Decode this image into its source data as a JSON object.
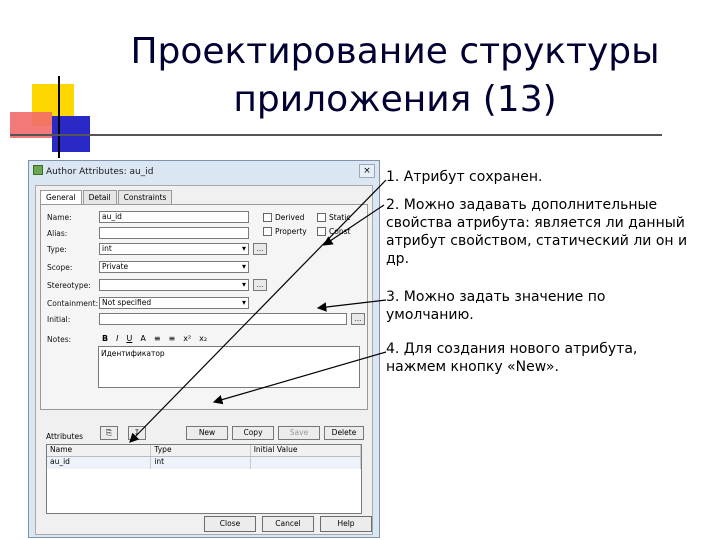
{
  "slide": {
    "title_line1": "Проектирование структуры",
    "title_line2": "приложения (13)"
  },
  "dialog": {
    "title": "Author Attributes: au_id",
    "close": "×",
    "tabs": [
      "General",
      "Detail",
      "Constraints"
    ],
    "labels": {
      "name": "Name:",
      "alias": "Alias:",
      "type": "Type:",
      "scope": "Scope:",
      "stereotype": "Stereotype:",
      "containment": "Containment:",
      "initial": "Initial:",
      "notes": "Notes:",
      "attributes": "Attributes"
    },
    "values": {
      "name": "au_id",
      "alias": "",
      "type": "int",
      "scope": "Private",
      "stereotype": "",
      "containment": "Not specified",
      "initial": "",
      "notes_text": "Идентификатор"
    },
    "checkboxes": {
      "derived": "Derived",
      "static": "Static",
      "property": "Property",
      "const": "Const"
    },
    "ellipsis": "...",
    "toolbar": [
      "B",
      "I",
      "U",
      "A",
      "≡",
      "≡",
      "x²",
      "x₂"
    ],
    "attr_icon_1": "⎘",
    "attr_icon_2": "↧",
    "buttons": {
      "new": "New",
      "copy": "Copy",
      "save": "Save",
      "delete": "Delete",
      "close": "Close",
      "cancel": "Cancel",
      "help": "Help"
    },
    "grid": {
      "headers": [
        "Name",
        "Type",
        "Initial Value"
      ],
      "rows": [
        [
          "au_id",
          "int",
          ""
        ]
      ]
    }
  },
  "bullets": [
    "1. Атрибут сохранен.",
    "2. Можно задавать дополнительные свойства атрибута: является ли данный атрибут свойством, статический ли он и др.",
    "3. Можно задать значение по умолчанию.",
    "4. Для создания нового атрибута, нажмем кнопку «New»."
  ],
  "colors": {
    "square_yellow": "#ffd700",
    "square_red": "#f26b6b",
    "square_blue": "#2929c8",
    "title_text": "#000033"
  }
}
